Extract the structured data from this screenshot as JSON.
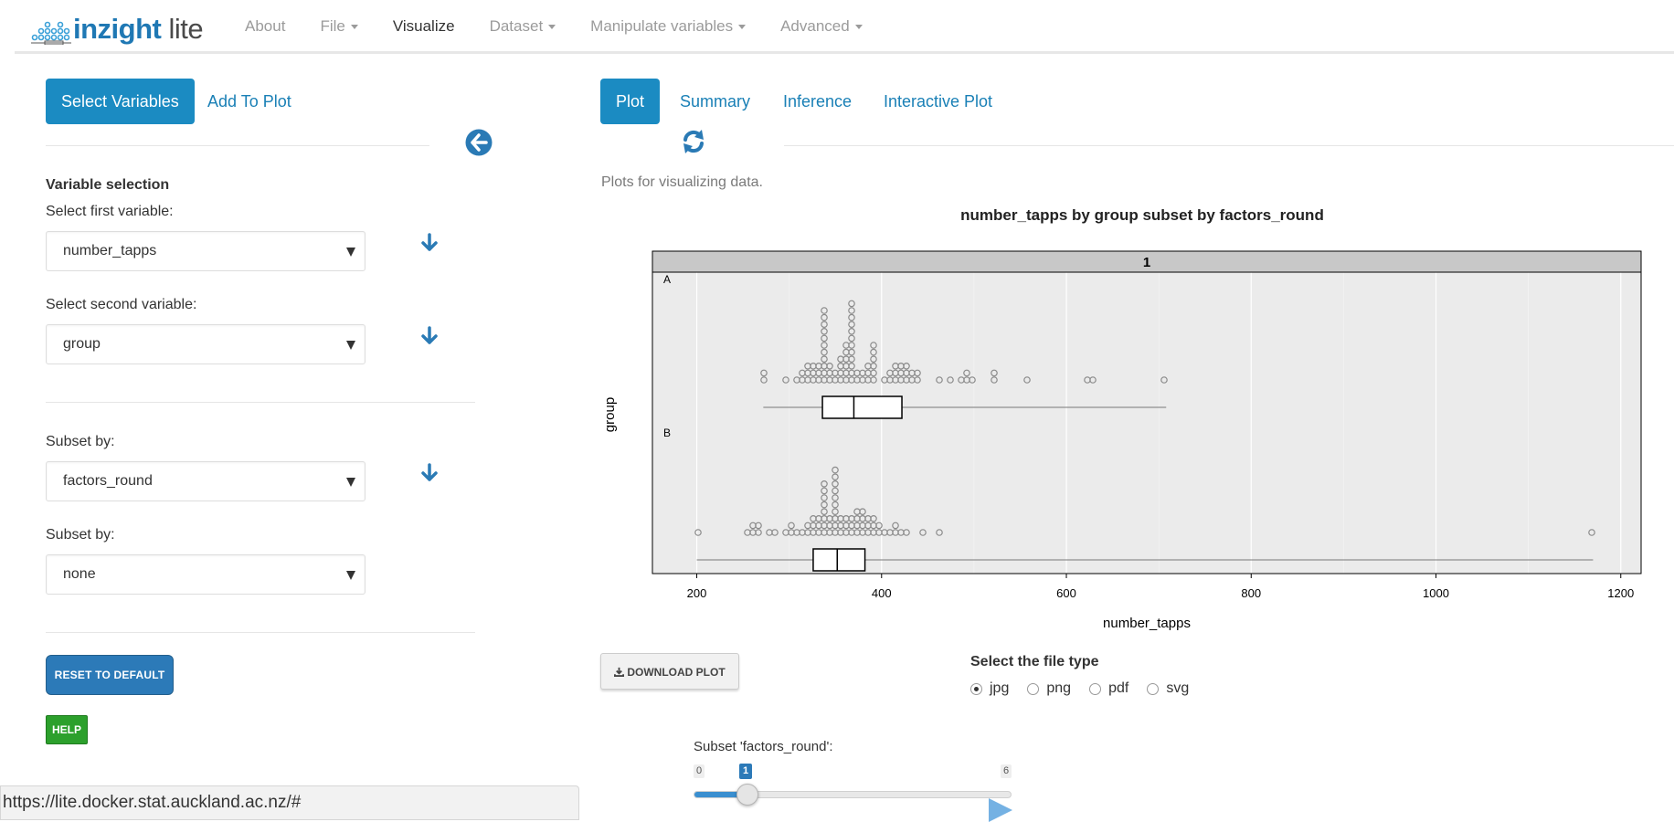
{
  "navbar": {
    "brand": {
      "part1": "inzight",
      "part2": " lite"
    },
    "items": [
      {
        "label": "About",
        "has_caret": false,
        "active": false
      },
      {
        "label": "File",
        "has_caret": true,
        "active": false
      },
      {
        "label": "Visualize",
        "has_caret": false,
        "active": true
      },
      {
        "label": "Dataset",
        "has_caret": true,
        "active": false
      },
      {
        "label": "Manipulate variables",
        "has_caret": true,
        "active": false
      },
      {
        "label": "Advanced",
        "has_caret": true,
        "active": false
      }
    ]
  },
  "left_tabs": [
    {
      "label": "Select Variables",
      "active": true
    },
    {
      "label": "Add To Plot",
      "active": false
    }
  ],
  "right_tabs": [
    {
      "label": "Plot",
      "active": true
    },
    {
      "label": "Summary",
      "active": false
    },
    {
      "label": "Inference",
      "active": false
    },
    {
      "label": "Interactive Plot",
      "active": false
    }
  ],
  "variables": {
    "section_title": "Variable selection",
    "first_label": "Select first variable:",
    "first_value": "number_tapps",
    "second_label": "Select second variable:",
    "second_value": "group",
    "subset1_label": "Subset by:",
    "subset1_value": "factors_round",
    "subset2_label": "Subset by:",
    "subset2_value": "none"
  },
  "buttons": {
    "reset": "RESET TO DEFAULT",
    "help": "HELP",
    "download": "DOWNLOAD PLOT"
  },
  "status_url": "https://lite.docker.stat.auckland.ac.nz/#",
  "plot_panel": {
    "description": "Plots for visualizing data.",
    "file_type_label": "Select the file type",
    "file_types": [
      {
        "label": "jpg",
        "checked": true
      },
      {
        "label": "png",
        "checked": false
      },
      {
        "label": "pdf",
        "checked": false
      },
      {
        "label": "svg",
        "checked": false
      }
    ]
  },
  "slider": {
    "label": "Subset 'factors_round':",
    "min": 0,
    "max": 6,
    "value": 1,
    "min_label": "0",
    "max_label": "6",
    "value_label": "1"
  },
  "colors": {
    "primary": "#1b8bc2",
    "link": "#1a80b6",
    "reset": "#2c7ab8",
    "help": "#2ca02c",
    "slider_fill": "#3a8fd0"
  },
  "icons": [
    "back-arrow-icon",
    "refresh-icon",
    "down-arrow-icon",
    "download-icon",
    "play-icon"
  ],
  "chart_data": {
    "type": "scatter",
    "subtype": "dotplot-with-boxplot",
    "title": "number_tapps by group subset by factors_round",
    "panel_label": "1",
    "xlabel": "number_tapps",
    "ylabel": "group",
    "xlim": [
      152,
      1222
    ],
    "x_ticks": [
      200,
      400,
      600,
      800,
      1000,
      1200
    ],
    "grid": true,
    "groups": [
      {
        "name": "A",
        "dots": [
          272,
          272,
          298,
          310,
          312,
          316,
          318,
          320,
          322,
          324,
          326,
          328,
          330,
          332,
          334,
          336,
          336,
          336,
          336,
          336,
          336,
          336,
          336,
          336,
          338,
          340,
          342,
          344,
          346,
          350,
          352,
          354,
          356,
          358,
          358,
          360,
          360,
          360,
          362,
          362,
          364,
          366,
          368,
          370,
          370,
          370,
          370,
          370,
          370,
          370,
          370,
          370,
          370,
          372,
          376,
          380,
          382,
          384,
          386,
          388,
          390,
          390,
          392,
          392,
          392,
          394,
          402,
          410,
          412,
          414,
          416,
          418,
          420,
          420,
          422,
          424,
          426,
          428,
          430,
          432,
          436,
          440,
          462,
          474,
          484,
          490,
          494,
          496,
          520,
          524,
          560,
          624,
          630,
          708
        ],
        "box": {
          "min": 272,
          "q1": 336,
          "median": 370,
          "q3": 422,
          "max": 708
        }
      },
      {
        "name": "B",
        "dots": [
          200,
          252,
          258,
          262,
          266,
          268,
          276,
          282,
          296,
          300,
          304,
          310,
          316,
          320,
          322,
          324,
          326,
          328,
          330,
          332,
          334,
          336,
          338,
          338,
          340,
          340,
          340,
          340,
          340,
          342,
          344,
          346,
          348,
          350,
          350,
          350,
          350,
          350,
          350,
          350,
          350,
          352,
          354,
          356,
          358,
          360,
          362,
          364,
          366,
          368,
          370,
          372,
          374,
          376,
          376,
          378,
          380,
          380,
          382,
          384,
          386,
          388,
          390,
          392,
          394,
          396,
          400,
          406,
          410,
          414,
          418,
          422,
          426,
          444,
          462,
          1170
        ],
        "box": {
          "min": 200,
          "q1": 326,
          "median": 352,
          "q3": 382,
          "max": 1170
        }
      }
    ]
  }
}
